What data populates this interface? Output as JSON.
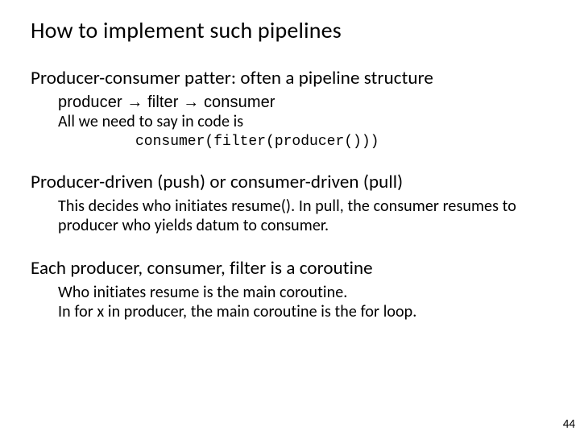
{
  "title": "How to implement such pipelines",
  "sections": [
    {
      "heading": "Producer-consumer patter: often a pipeline structure",
      "lines": [
        "producer → filter → consumer",
        "All we need to say in code is"
      ],
      "code": "consumer(filter(producer()))"
    },
    {
      "heading": "Producer-driven (push) or consumer-driven (pull)",
      "lines": [
        "This decides who initiates resume().  In pull, the consumer resumes to producer who yields datum to consumer."
      ]
    },
    {
      "heading": "Each producer, consumer, filter is a coroutine",
      "lines": [
        "Who initiates resume is the main coroutine.",
        "In for x in producer, the main coroutine is the for loop."
      ]
    }
  ],
  "page_number": "44"
}
